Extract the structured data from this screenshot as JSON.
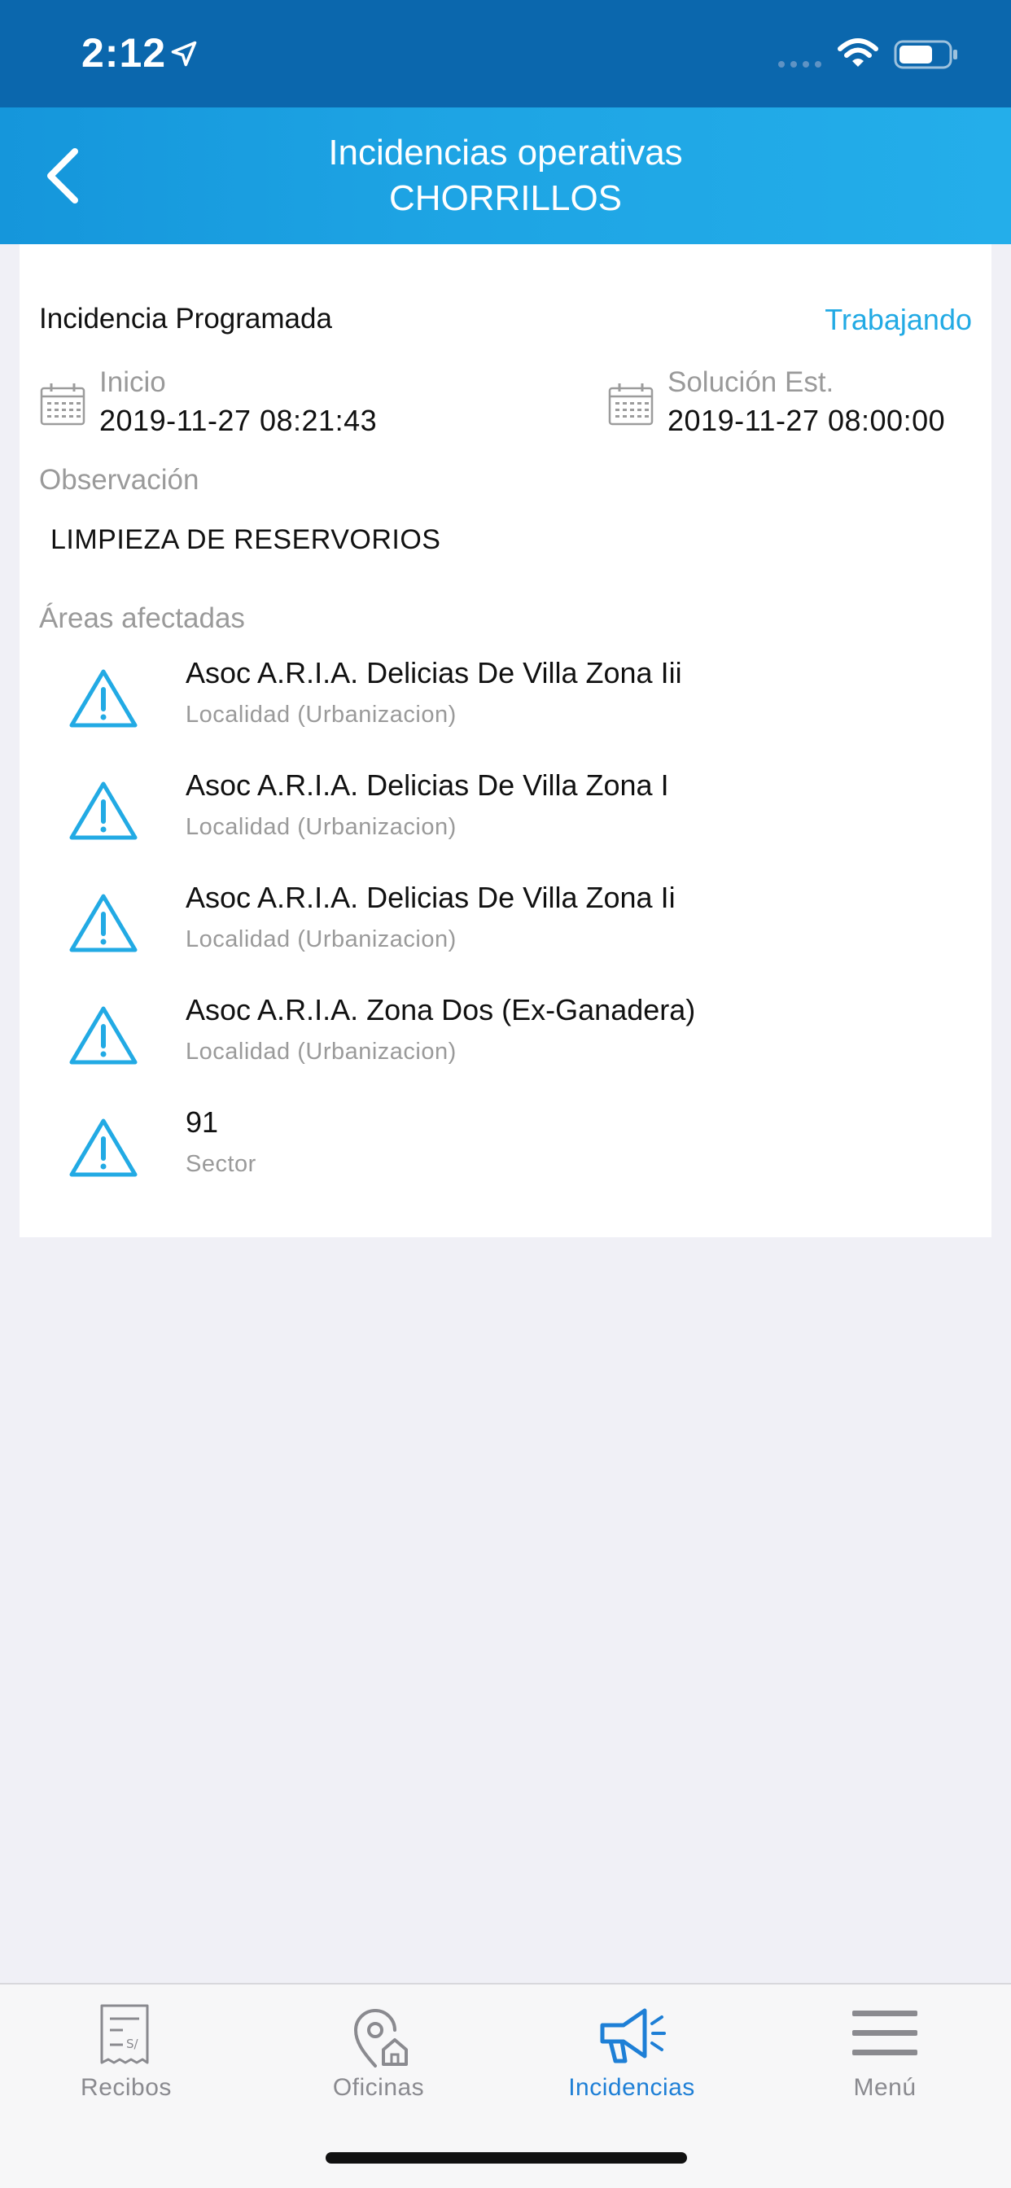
{
  "status_bar": {
    "time": "2:12"
  },
  "header": {
    "title_line1": "Incidencias operativas",
    "title_line2": "CHORRILLOS"
  },
  "incident": {
    "type": "Incidencia Programada",
    "status": "Trabajando",
    "start_caption": "Inicio",
    "start_value": "2019-11-27 08:21:43",
    "end_caption": "Solución Est.",
    "end_value": "2019-11-27 08:00:00",
    "observation_caption": "Observación",
    "observation_value": "LIMPIEZA DE RESERVORIOS",
    "areas_caption": "Áreas afectadas",
    "areas": [
      {
        "name": "Asoc A.R.I.A. Delicias De Villa Zona Iii",
        "type": "Localidad (Urbanizacion)"
      },
      {
        "name": "Asoc A.R.I.A. Delicias De Villa Zona I",
        "type": "Localidad (Urbanizacion)"
      },
      {
        "name": "Asoc A.R.I.A. Delicias De Villa Zona Ii",
        "type": "Localidad (Urbanizacion)"
      },
      {
        "name": "Asoc A.R.I.A. Zona Dos (Ex-Ganadera)",
        "type": "Localidad (Urbanizacion)"
      },
      {
        "name": "91",
        "type": "Sector"
      }
    ]
  },
  "tabs": [
    {
      "label": "Recibos",
      "icon": "receipt-icon"
    },
    {
      "label": "Oficinas",
      "icon": "office-location-icon"
    },
    {
      "label": "Incidencias",
      "icon": "megaphone-icon",
      "active": true
    },
    {
      "label": "Menú",
      "icon": "hamburger-menu-icon"
    }
  ],
  "colors": {
    "status_bar": "#0b67ad",
    "nav_bar": "#1da3e3",
    "accent": "#22aae4",
    "active_tab": "#1e7fd6",
    "background": "#f0f0f6"
  }
}
